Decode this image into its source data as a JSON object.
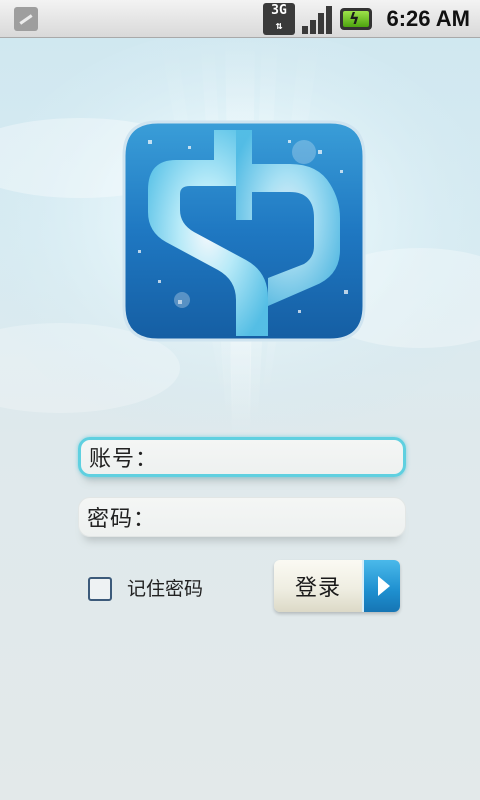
{
  "status_bar": {
    "network_type": "3G",
    "time": "6:26 AM",
    "icons": [
      "notification-icon",
      "3g-data-icon",
      "signal-icon",
      "battery-charging-icon"
    ]
  },
  "logo": {
    "name": "app-logo",
    "colors": {
      "outer": "#1f78c2",
      "inner": "#6fd3ee",
      "glow": "#d9f5ff"
    }
  },
  "login_form": {
    "account_label": "账号：",
    "password_label": "密码：",
    "remember_label": "记住密码",
    "remember_checked": false,
    "login_button_label": "登录"
  },
  "colors": {
    "focus_border": "#5fd0e0",
    "button_accent": "#1e8fcf"
  }
}
